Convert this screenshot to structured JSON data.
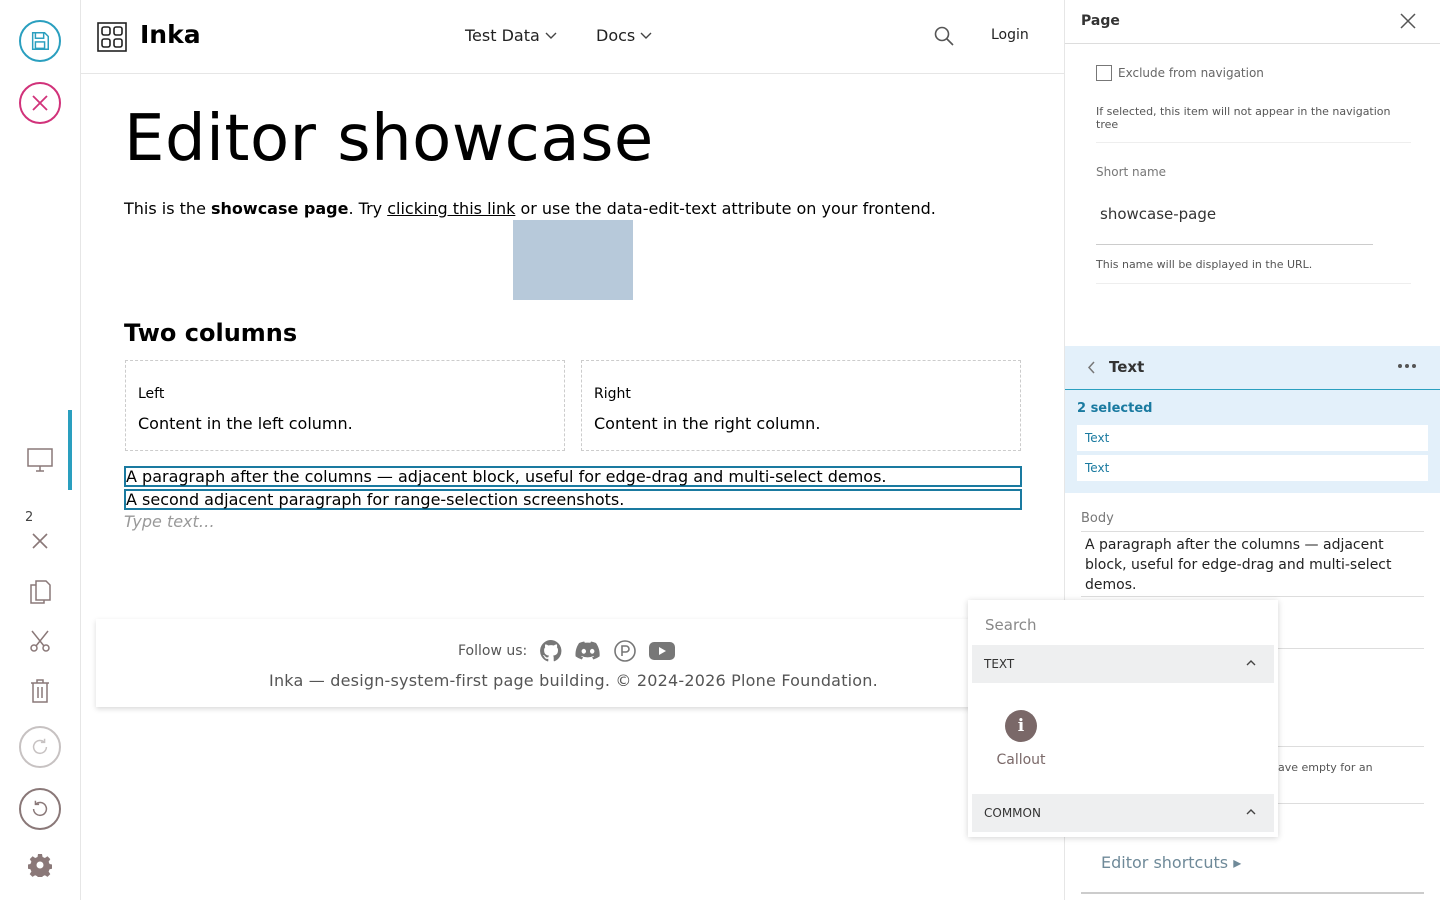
{
  "header": {
    "brand": "Inka",
    "nav": [
      {
        "label": "Test Data"
      },
      {
        "label": "Docs"
      }
    ],
    "login": "Login"
  },
  "toolbar": {
    "selection_count": "2"
  },
  "main": {
    "title": "Editor showcase",
    "intro": {
      "pre": "This is the ",
      "bold": "showcase page",
      "mid": ". Try ",
      "link": "clicking this link",
      "post": " or use the data-edit-text attribute on your frontend."
    },
    "section_heading": "Two columns",
    "columns": [
      {
        "title": "Left",
        "body": "Content in the left column."
      },
      {
        "title": "Right",
        "body": "Content in the right column."
      }
    ],
    "paragraphs": [
      "A paragraph after the columns — adjacent block, useful for edge-drag and multi-select demos.",
      "A second adjacent paragraph for range-selection screenshots."
    ],
    "placeholder": "Type text…"
  },
  "footer": {
    "follow_label": "Follow us:",
    "copyright": "Inka — design-system-first page building. © 2024-2026 Plone Foundation."
  },
  "sidebar": {
    "title": "Page",
    "exclude_label": "Exclude from navigation",
    "exclude_help": "If selected, this item will not appear in the navigation tree",
    "short_name_label": "Short name",
    "short_name_value": "showcase-page",
    "short_name_help": "This name will be displayed in the URL.",
    "block_title": "Text",
    "selected_count": "2 selected",
    "selected_items": [
      "Text",
      "Text"
    ],
    "body_label": "Body",
    "body_value": "A paragraph after the columns — adjacent block, useful for edge-drag and multi-select demos.",
    "partial_help": "ave empty for an",
    "shortcuts": "Editor shortcuts ▸"
  },
  "popup": {
    "search_placeholder": "Search",
    "sections": [
      {
        "label": "TEXT"
      },
      {
        "label": "COMMON"
      }
    ],
    "blocks": [
      {
        "label": "Callout",
        "icon": "i"
      }
    ]
  },
  "colors": {
    "accent": "#2a9fbf",
    "cancel": "#d1327a",
    "selection_bg": "#e3f0fa"
  }
}
